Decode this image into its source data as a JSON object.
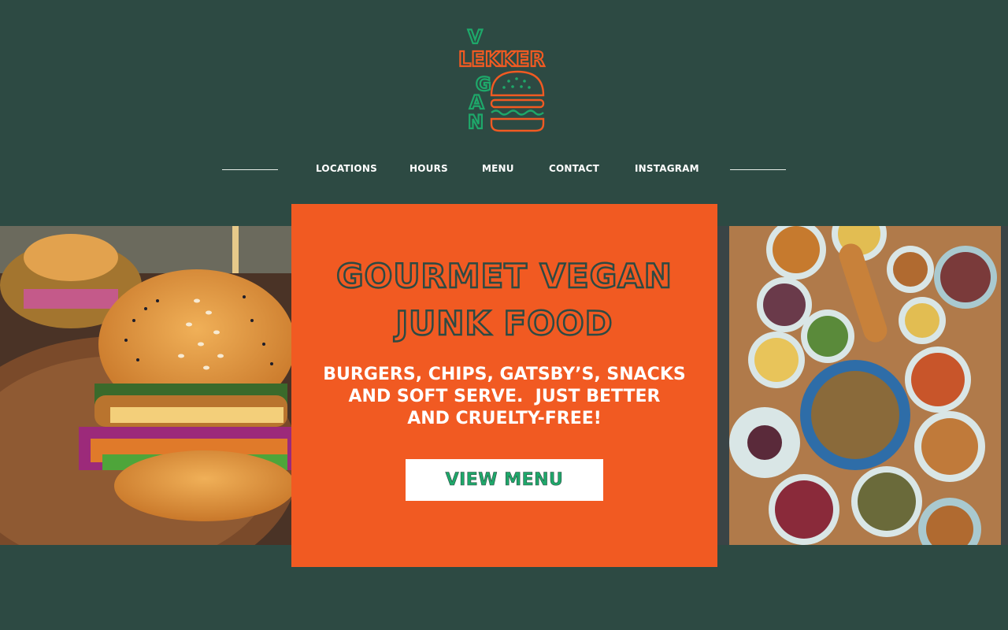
{
  "brand": {
    "logo_word_lekker": "LEKKER",
    "logo_word_vegan": "VEGAN",
    "colors": {
      "orange": "#f15a22",
      "green": "#1ea86a",
      "background": "#2d4a43"
    }
  },
  "nav": {
    "items": [
      {
        "label": "LOCATIONS"
      },
      {
        "label": "HOURS"
      },
      {
        "label": "MENU"
      },
      {
        "label": "CONTACT"
      },
      {
        "label": "INSTAGRAM"
      }
    ]
  },
  "hero": {
    "title_line1": "GOURMET VEGAN",
    "title_line2": "JUNK FOOD",
    "subtitle_line1": "BURGERS, CHIPS, GATSBY’S, SNACKS",
    "subtitle_line2": "AND SOFT SERVE.  JUST BETTER",
    "subtitle_line3": "AND CRUELTY-FREE!",
    "cta_label": "VIEW MENU"
  },
  "images": {
    "left": "vegan-burger-photo",
    "right": "table-of-dishes-photo"
  }
}
